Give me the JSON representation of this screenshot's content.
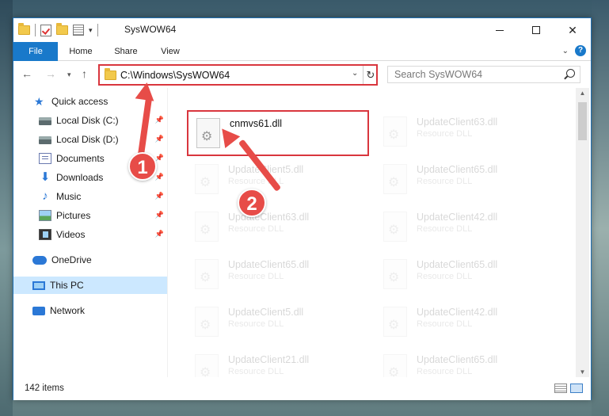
{
  "window": {
    "title": "SysWOW64"
  },
  "ribbon": {
    "tabs": [
      "File",
      "Home",
      "Share",
      "View"
    ]
  },
  "address": {
    "path": "C:\\Windows\\SysWOW64",
    "search_placeholder": "Search SysWOW64"
  },
  "sidebar": {
    "items": [
      {
        "label": "Quick access",
        "icon": "star-icon"
      },
      {
        "label": "Local Disk (C:)",
        "icon": "disk-icon",
        "pinned": true
      },
      {
        "label": "Local Disk (D:)",
        "icon": "disk-icon",
        "pinned": true
      },
      {
        "label": "Documents",
        "icon": "documents-icon",
        "pinned": true
      },
      {
        "label": "Downloads",
        "icon": "downloads-icon",
        "pinned": true
      },
      {
        "label": "Music",
        "icon": "music-icon",
        "pinned": true
      },
      {
        "label": "Pictures",
        "icon": "pictures-icon",
        "pinned": true
      },
      {
        "label": "Videos",
        "icon": "videos-icon",
        "pinned": true
      },
      {
        "label": "OneDrive",
        "icon": "onedrive-icon"
      },
      {
        "label": "This PC",
        "icon": "this-pc-icon",
        "selected": true
      },
      {
        "label": "Network",
        "icon": "network-icon"
      }
    ]
  },
  "files": {
    "highlighted": {
      "name": "cnmvs61.dll",
      "type": ""
    },
    "items": [
      {
        "name": "UpdateClient63.dll",
        "type": "Resource DLL"
      },
      {
        "name": "UpdateClient5.dll",
        "type": "Resource DLL"
      },
      {
        "name": "UpdateClient65.dll",
        "type": "Resource DLL"
      },
      {
        "name": "UpdateClient63.dll",
        "type": "Resource DLL"
      },
      {
        "name": "UpdateClient42.dll",
        "type": "Resource DLL"
      },
      {
        "name": "UpdateClient65.dll",
        "type": "Resource DLL"
      },
      {
        "name": "UpdateClient65.dll",
        "type": "Resource DLL"
      },
      {
        "name": "UpdateClient5.dll",
        "type": "Resource DLL"
      },
      {
        "name": "UpdateClient42.dll",
        "type": "Resource DLL"
      },
      {
        "name": "UpdateClient21.dll",
        "type": "Resource DLL"
      },
      {
        "name": "UpdateClient65.dll",
        "type": "Resource DLL"
      }
    ]
  },
  "status": {
    "item_count": "142 items"
  },
  "annotations": {
    "step1": "1",
    "step2": "2",
    "color": "#e74c48"
  }
}
